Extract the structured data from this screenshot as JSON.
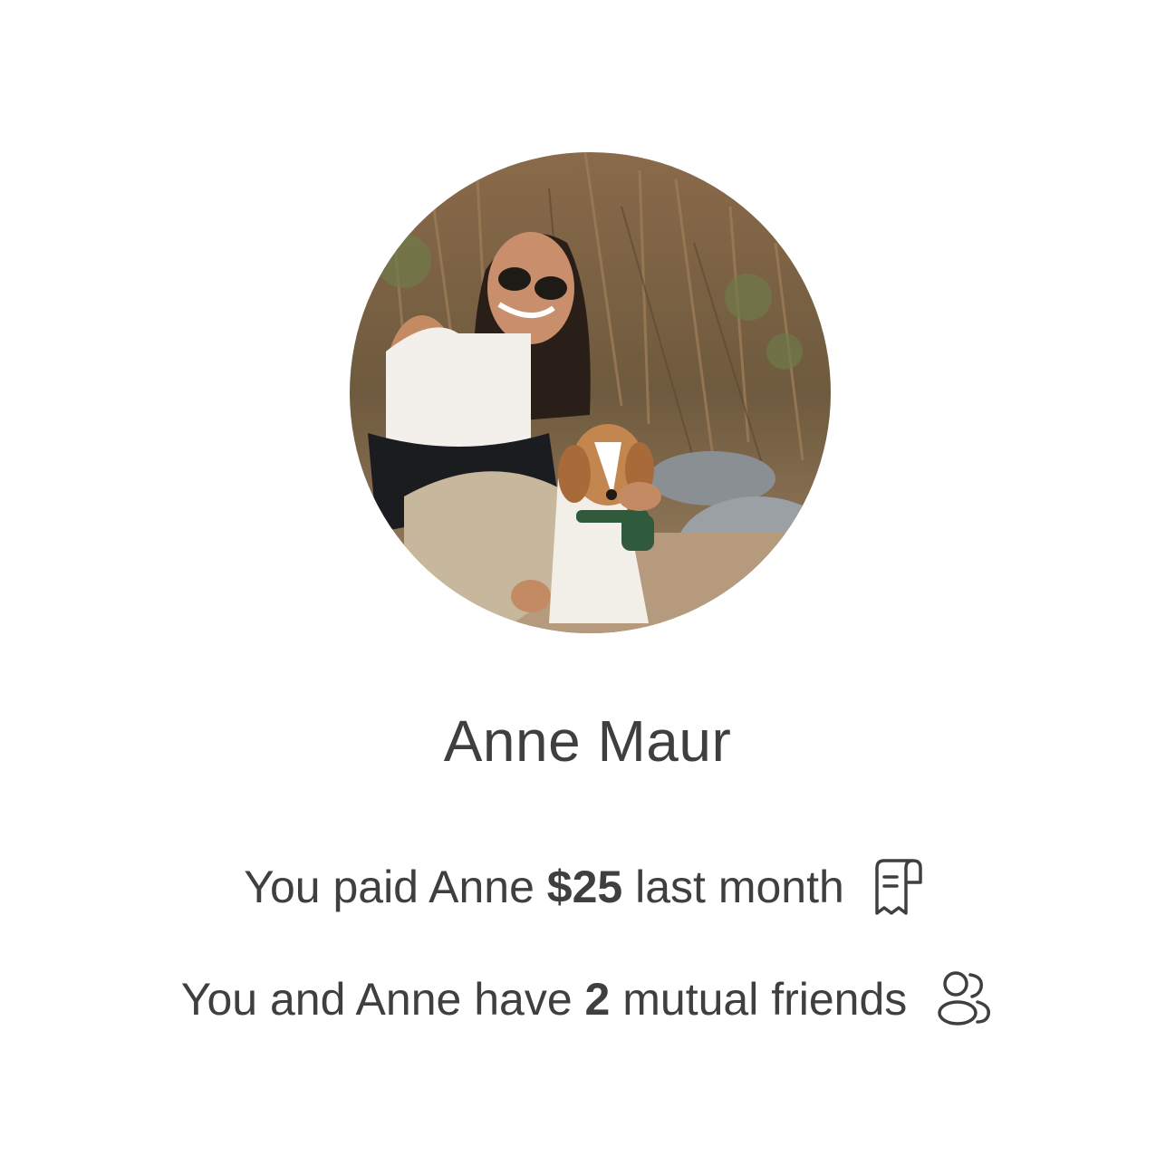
{
  "profile": {
    "name": "Anne Maur",
    "avatar_alt": "avatar-photo"
  },
  "payment": {
    "prefix": "You paid Anne ",
    "amount": "$25",
    "suffix": " last month",
    "icon": "receipt-icon"
  },
  "mutual": {
    "prefix": "You and Anne have ",
    "count": "2",
    "suffix": " mutual friends",
    "icon": "users-icon"
  },
  "colors": {
    "text": "#3f3f3f",
    "background": "#ffffff"
  }
}
